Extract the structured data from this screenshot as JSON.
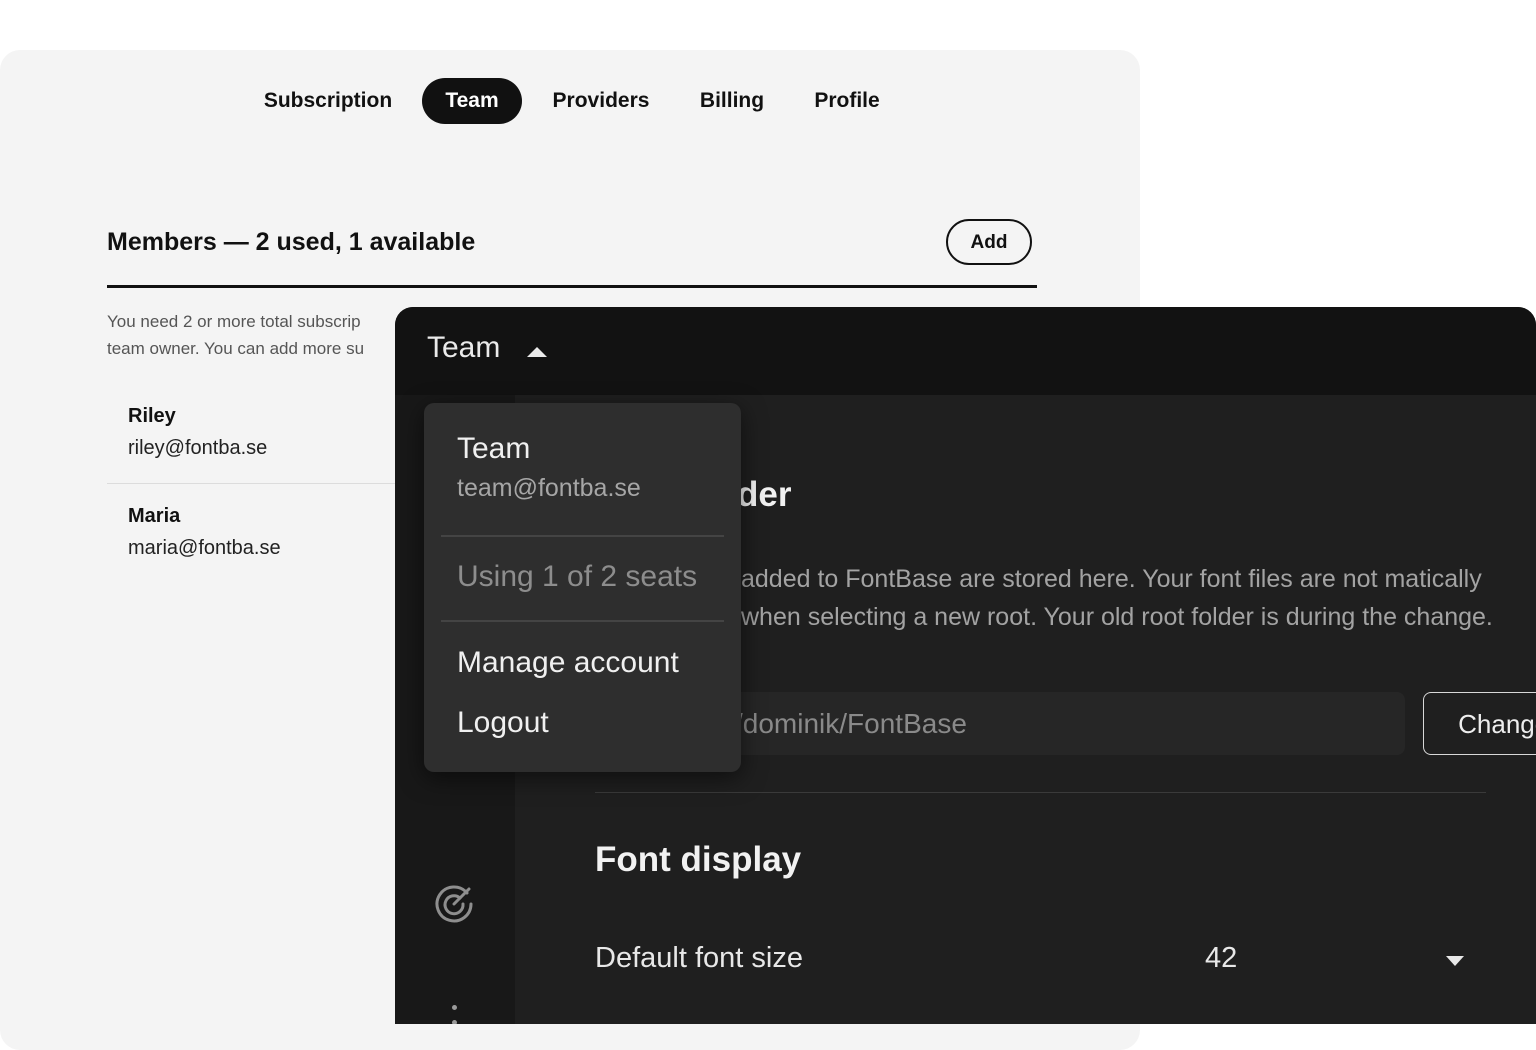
{
  "web": {
    "tabs": [
      {
        "label": "Subscription",
        "active": false
      },
      {
        "label": "Team",
        "active": true
      },
      {
        "label": "Providers",
        "active": false
      },
      {
        "label": "Billing",
        "active": false
      },
      {
        "label": "Profile",
        "active": false
      }
    ],
    "members_title": "Members — 2 used, 1 available",
    "add_label": "Add",
    "note_line1": "You need 2 or more total subscrip",
    "note_line2": "team owner. You can add more su",
    "members": [
      {
        "name": "Riley",
        "email": "riley@fontba.se"
      },
      {
        "name": "Maria",
        "email": "maria@fontba.se"
      }
    ]
  },
  "app": {
    "titlebar_label": "Team",
    "sidebar_icons": [
      "radar-icon",
      "more-vertical-icon"
    ],
    "root_section_title": "der",
    "root_description": "added to FontBase are stored here. Your font files are not matically when selecting a new root. Your old root folder is during the change.",
    "root_path": "/dominik/FontBase",
    "change_label": "Change...",
    "font_display_title": "Font display",
    "default_font_size_label": "Default font size",
    "default_font_size_value": "42"
  },
  "dropdown": {
    "team_name": "Team",
    "team_email": "team@fontba.se",
    "seats_text": "Using 1 of 2 seats",
    "manage_label": "Manage account",
    "logout_label": "Logout"
  },
  "colors": {
    "dark_bg": "#1f1f1f",
    "titlebar_bg": "#121212",
    "dropdown_bg": "#2e2e2e",
    "light_bg": "#f4f4f4",
    "accent_dark": "#111111"
  }
}
